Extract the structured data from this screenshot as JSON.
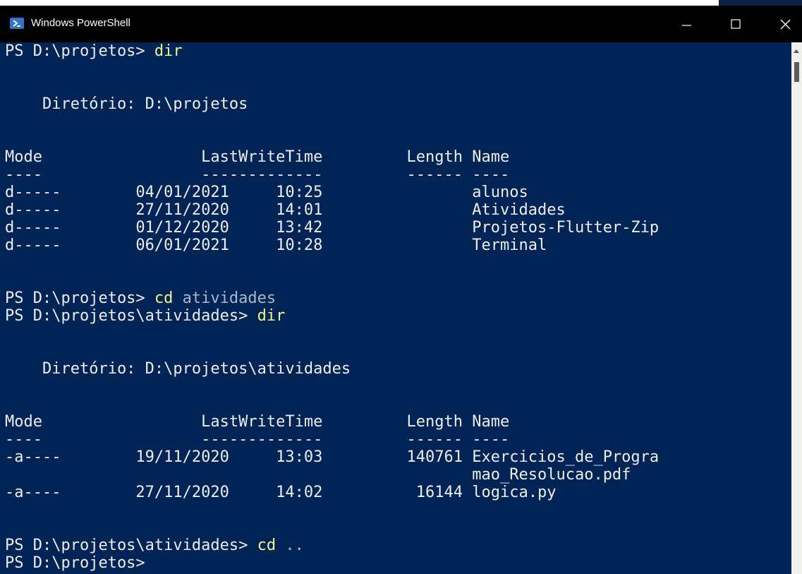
{
  "window": {
    "title": "Windows PowerShell",
    "icon": "powershell-icon",
    "controls": [
      "minimize-icon",
      "maximize-icon",
      "close-icon"
    ]
  },
  "colors": {
    "background": "#012456",
    "text": "#eeedf0",
    "command": "#f1f587",
    "argument": "#aab7c8",
    "titlebar": "#000000"
  },
  "console": {
    "lines": [
      {
        "prompt": "PS D:\\projetos> ",
        "command": "dir",
        "args": ""
      },
      {
        "text": ""
      },
      {
        "text": ""
      },
      {
        "text": "    Diretório: D:\\projetos"
      },
      {
        "text": ""
      },
      {
        "text": ""
      },
      {
        "text": "Mode                 LastWriteTime         Length Name"
      },
      {
        "text": "----                 -------------         ------ ----"
      },
      {
        "text": "d-----        04/01/2021     10:25                alunos"
      },
      {
        "text": "d-----        27/11/2020     14:01                Atividades"
      },
      {
        "text": "d-----        01/12/2020     13:42                Projetos-Flutter-Zip"
      },
      {
        "text": "d-----        06/01/2021     10:28                Terminal"
      },
      {
        "text": ""
      },
      {
        "text": ""
      },
      {
        "prompt": "PS D:\\projetos> ",
        "command": "cd",
        "args": " atividades"
      },
      {
        "prompt": "PS D:\\projetos\\atividades> ",
        "command": "dir",
        "args": ""
      },
      {
        "text": ""
      },
      {
        "text": ""
      },
      {
        "text": "    Diretório: D:\\projetos\\atividades"
      },
      {
        "text": ""
      },
      {
        "text": ""
      },
      {
        "text": "Mode                 LastWriteTime         Length Name"
      },
      {
        "text": "----                 -------------         ------ ----"
      },
      {
        "text": "-a----        19/11/2020     13:03         140761 Exercicios_de_Progra"
      },
      {
        "text": "                                                  mao_Resolucao.pdf"
      },
      {
        "text": "-a----        27/11/2020     14:02          16144 logica.py"
      },
      {
        "text": ""
      },
      {
        "text": ""
      },
      {
        "prompt": "PS D:\\projetos\\atividades> ",
        "command": "cd",
        "args": " .."
      },
      {
        "prompt": "PS D:\\projetos>",
        "command": "",
        "args": ""
      }
    ]
  }
}
